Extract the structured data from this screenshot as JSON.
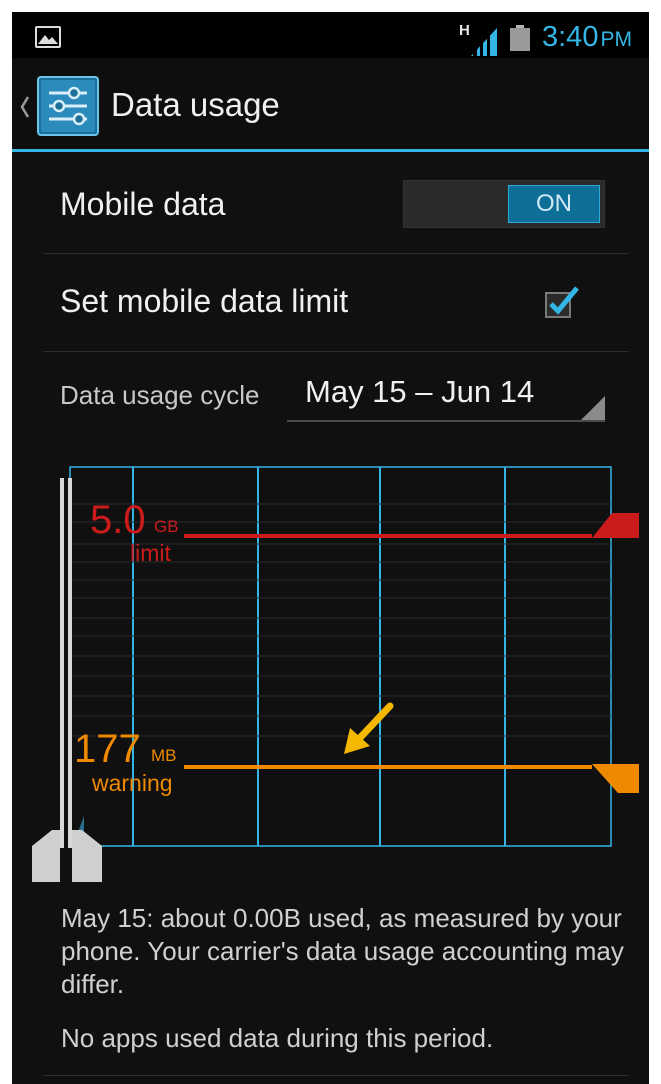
{
  "status_bar": {
    "network_badge": "H",
    "time": "3:40",
    "ampm": "PM"
  },
  "action_bar": {
    "title": "Data usage"
  },
  "mobile_data": {
    "label": "Mobile data",
    "toggle_state": "ON"
  },
  "mobile_limit": {
    "label": "Set mobile data limit",
    "checked": true
  },
  "cycle": {
    "label": "Data usage cycle",
    "value": "May 15 – Jun 14"
  },
  "chart": {
    "limit": {
      "value": "5.0",
      "unit": "GB",
      "caption": "limit",
      "color": "#cc1b1b"
    },
    "warning": {
      "value": "177",
      "unit": "MB",
      "caption": "warning",
      "color": "#ef8a00"
    },
    "grid_color": "#33b5e5"
  },
  "summary": {
    "usage_text": "May 15: about 0.00B used, as measured by your phone. Your carrier's data usage accounting may differ.",
    "apps_text": "No apps used data during this period."
  },
  "annotation": {
    "color": "#f5b800"
  }
}
